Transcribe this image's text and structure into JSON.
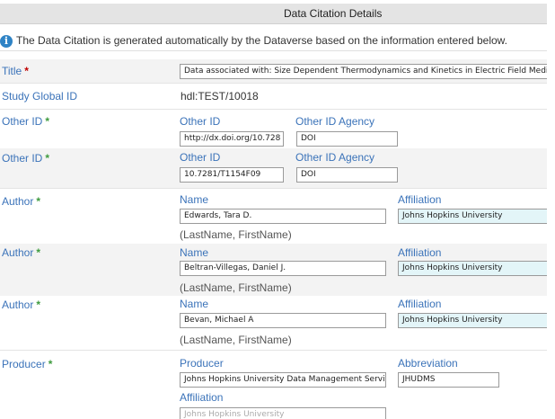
{
  "header": {
    "title": "Data Citation Details"
  },
  "info": {
    "icon": "info-icon",
    "text": "The Data Citation is generated automatically by the Dataverse based on the information entered below."
  },
  "title_field": {
    "label": "Title",
    "required": "*",
    "value": "Data associated with: Size Dependent Thermodynamics and Kinetics in Electric Field Mediat"
  },
  "global_id": {
    "label": "Study Global ID",
    "value": "hdl:TEST/10018"
  },
  "other_ids": [
    {
      "label": "Other ID",
      "required": "*",
      "id_label": "Other ID",
      "agency_label": "Other ID Agency",
      "id_value": "http://dx.doi.org/10.728",
      "agency_value": "DOI"
    },
    {
      "label": "Other ID",
      "required": "*",
      "id_label": "Other ID",
      "agency_label": "Other ID Agency",
      "id_value": "10.7281/T1154F09",
      "agency_value": "DOI"
    }
  ],
  "authors": [
    {
      "label": "Author",
      "required": "*",
      "name_label": "Name",
      "affiliation_label": "Affiliation",
      "name_value": "Edwards, Tara D.",
      "affiliation_value": "Johns Hopkins University",
      "hint": "(LastName, FirstName)"
    },
    {
      "label": "Author",
      "required": "*",
      "name_label": "Name",
      "affiliation_label": "Affiliation",
      "name_value": "Beltran-Villegas, Daniel J.",
      "affiliation_value": "Johns Hopkins University",
      "hint": "(LastName, FirstName)"
    },
    {
      "label": "Author",
      "required": "*",
      "name_label": "Name",
      "affiliation_label": "Affiliation",
      "name_value": "Bevan, Michael A",
      "affiliation_value": "Johns Hopkins University",
      "hint": "(LastName, FirstName)"
    }
  ],
  "producer": {
    "label": "Producer",
    "required": "*",
    "producer_label": "Producer",
    "abbreviation_label": "Abbreviation",
    "affiliation_label": "Affiliation",
    "producer_value": "Johns Hopkins University Data Management Servic",
    "abbreviation_value": "JHUDMS",
    "affiliation_value": "Johns Hopkins University"
  },
  "colors": {
    "label_blue": "#3b73b9",
    "required_red": "#c00000",
    "required_green": "#3e9b3e",
    "affiliation_bg": "#e3f5f8"
  }
}
